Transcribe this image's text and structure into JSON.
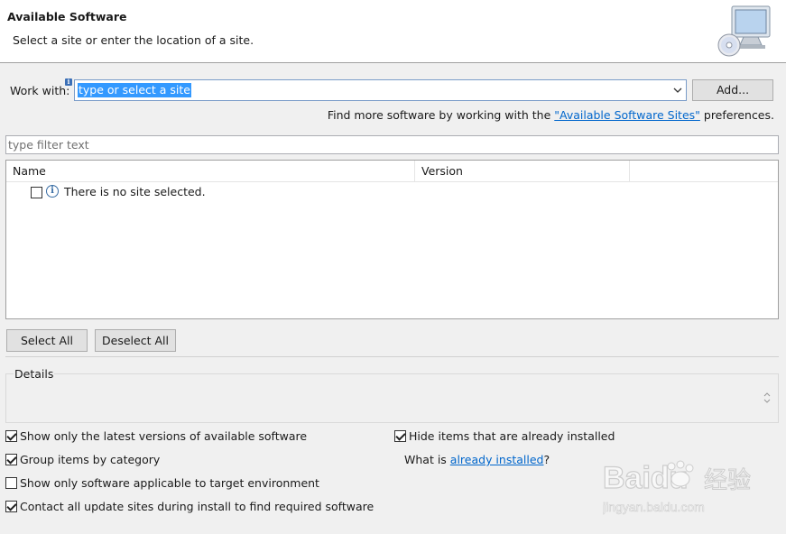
{
  "banner": {
    "title": "Available Software",
    "description": "Select a site or enter the location of a site."
  },
  "work_with": {
    "label": "Work with:",
    "value": "type or select a site",
    "add_label": "Add..."
  },
  "find_more": {
    "prefix": "Find more software by working with the ",
    "link": "\"Available Software Sites\"",
    "suffix": " preferences."
  },
  "filter": {
    "placeholder": "type filter text"
  },
  "table": {
    "columns": [
      "Name",
      "Version"
    ],
    "rows": [
      {
        "text": "There is no site selected.",
        "checked": false
      }
    ]
  },
  "buttons": {
    "select_all": "Select All",
    "deselect_all": "Deselect All"
  },
  "details": {
    "label": "Details"
  },
  "options": {
    "latest": {
      "label": "Show only the latest versions of available software",
      "checked": true
    },
    "group": {
      "label": "Group items by category",
      "checked": true
    },
    "target": {
      "label": "Show only software applicable to target environment",
      "checked": false
    },
    "contact": {
      "label": "Contact all update sites during install to find required software",
      "checked": true
    },
    "hide": {
      "label": "Hide items that are already installed",
      "checked": true
    }
  },
  "what_is": {
    "prefix": "What is ",
    "link": "already installed",
    "suffix": "?"
  },
  "watermark": {
    "brand": "Baidu",
    "brand_cn": "经验",
    "url": "jingyan.baidu.com"
  },
  "colors": {
    "link": "#0066cc",
    "selection": "#3399ff"
  }
}
